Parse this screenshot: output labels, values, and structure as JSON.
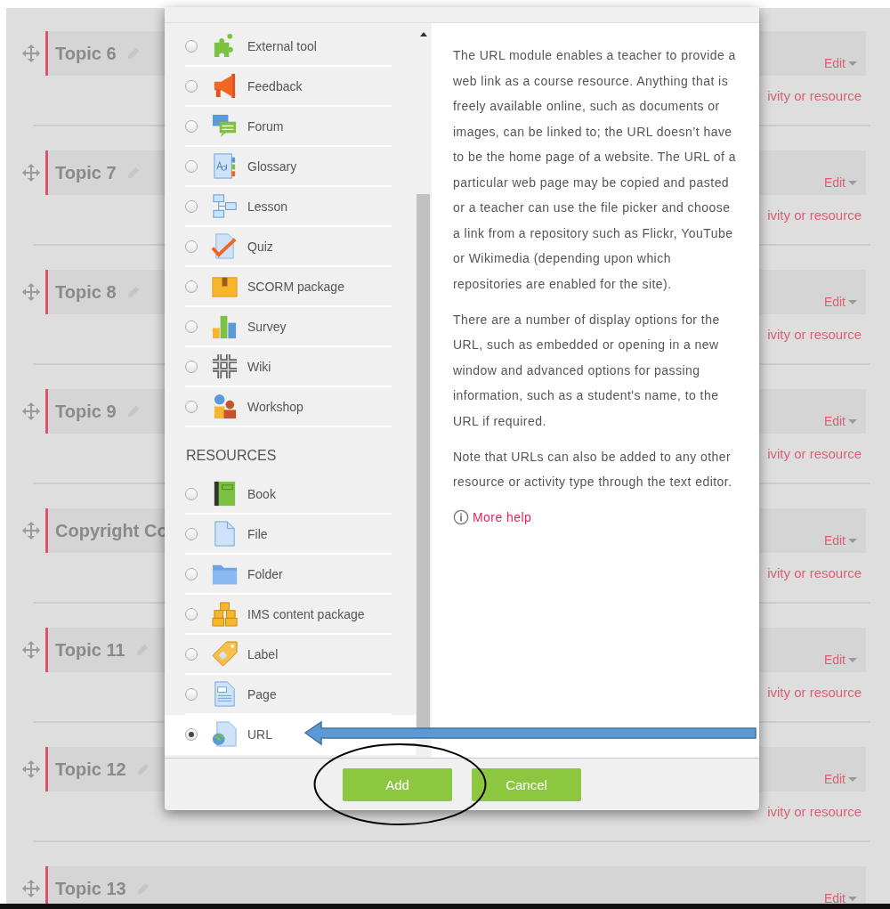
{
  "sections": [
    {
      "title": "Topic 6",
      "edit": "Edit",
      "add_link": "ivity or resource"
    },
    {
      "title": "Topic 7",
      "edit": "Edit",
      "add_link": "ivity or resource"
    },
    {
      "title": "Topic 8",
      "edit": "Edit",
      "add_link": "ivity or resource"
    },
    {
      "title": "Topic 9",
      "edit": "Edit",
      "add_link": "ivity or resource"
    },
    {
      "title": "Copyright Co",
      "edit": "Edit",
      "add_link": "ivity or resource"
    },
    {
      "title": "Topic 11",
      "edit": "Edit",
      "add_link": "ivity or resource"
    },
    {
      "title": "Topic 12",
      "edit": "Edit",
      "add_link": "ivity or resource"
    },
    {
      "title": "Topic 13",
      "edit": "Edit"
    }
  ],
  "chooser": {
    "activities": [
      {
        "label": "External tool",
        "selected": false
      },
      {
        "label": "Feedback",
        "selected": false
      },
      {
        "label": "Forum",
        "selected": false
      },
      {
        "label": "Glossary",
        "selected": false
      },
      {
        "label": "Lesson",
        "selected": false
      },
      {
        "label": "Quiz",
        "selected": false
      },
      {
        "label": "SCORM package",
        "selected": false
      },
      {
        "label": "Survey",
        "selected": false
      },
      {
        "label": "Wiki",
        "selected": false
      },
      {
        "label": "Workshop",
        "selected": false
      }
    ],
    "resources_heading": "RESOURCES",
    "resources": [
      {
        "label": "Book",
        "selected": false
      },
      {
        "label": "File",
        "selected": false
      },
      {
        "label": "Folder",
        "selected": false
      },
      {
        "label": "IMS content package",
        "selected": false
      },
      {
        "label": "Label",
        "selected": false
      },
      {
        "label": "Page",
        "selected": false
      },
      {
        "label": "URL",
        "selected": true
      }
    ],
    "description": [
      "The URL module enables a teacher to provide a web link as a course resource. Anything that is freely available online, such as documents or images, can be linked to; the URL doesn’t have to be the home page of a website. The URL of a particular web page may be copied and pasted or a teacher can use the file picker and choose a link from a repository such as Flickr, YouTube or Wikimedia (depending upon which repositories are enabled for the site).",
      "There are a number of display options for the URL, such as embedded or opening in a new window and advanced options for passing information, such as a student's name, to the URL if required.",
      "Note that URLs can also be added to any other resource or activity type through the text editor."
    ],
    "more_help": "More help",
    "buttons": [
      {
        "label": "Add"
      },
      {
        "label": "Cancel"
      }
    ]
  }
}
